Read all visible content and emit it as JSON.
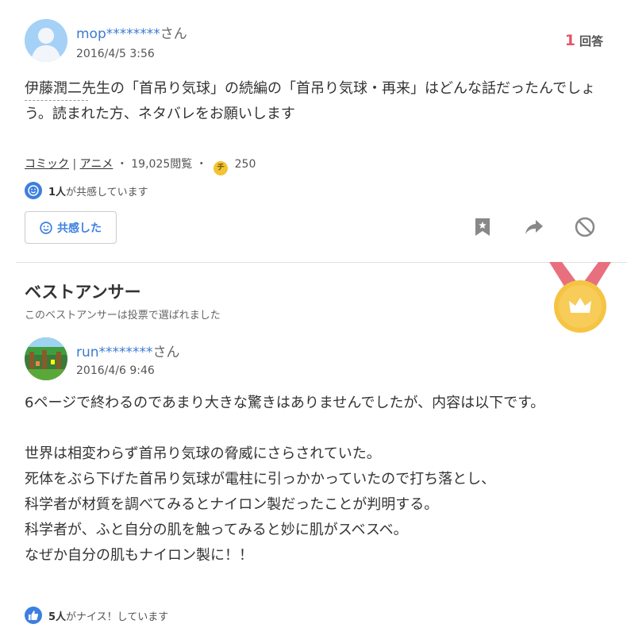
{
  "question": {
    "user": "mop********",
    "honorific": "さん",
    "date": "2016/4/5 3:56",
    "answer_count": "1",
    "answer_label": "回答",
    "body": "伊藤潤二先生の「首吊り気球」の続編の「首吊り気球・再来」はどんな話だったんでしょう。読まれた方、ネタバレをお願いします",
    "categories": [
      "コミック",
      "アニメ"
    ],
    "separator": "|",
    "views": "19,025閲覧",
    "dot": "・",
    "coin_symbol": "チ",
    "coin_amount": "250",
    "empathy_count": "1人",
    "empathy_text": "が共感しています",
    "empathy_button": "共感した"
  },
  "best_answer": {
    "title": "ベストアンサー",
    "subtitle": "このベストアンサーは投票で選ばれました",
    "user": "run********",
    "honorific": "さん",
    "date": "2016/4/6 9:46",
    "body_lines": [
      "6ページで終わるのであまり大きな驚きはありませんでしたが、内容は以下です。",
      "",
      "世界は相変わらず首吊り気球の脅威にさらされていた。",
      "死体をぶら下げた首吊り気球が電柱に引っかかっていたので打ち落とし、",
      "科学者が材質を調べてみるとナイロン製だったことが判明する。",
      "科学者が、ふと自分の肌を触ってみると妙に肌がスベスベ。",
      "なぜか自分の肌もナイロン製に！！"
    ],
    "nice_count": "5人",
    "nice_text": "がナイス！しています"
  },
  "colors": {
    "link_blue": "#3b7ad1",
    "accent_blue": "#3c7fe0",
    "answer_red": "#e5546a",
    "medal_gold": "#f5c443",
    "ribbon_pink": "#e8707e"
  },
  "icons": [
    "default-avatar-icon",
    "empathy-smile-icon",
    "bookmark-icon",
    "share-icon",
    "block-icon",
    "medal-crown-icon",
    "thumbs-up-icon",
    "coin-icon"
  ]
}
